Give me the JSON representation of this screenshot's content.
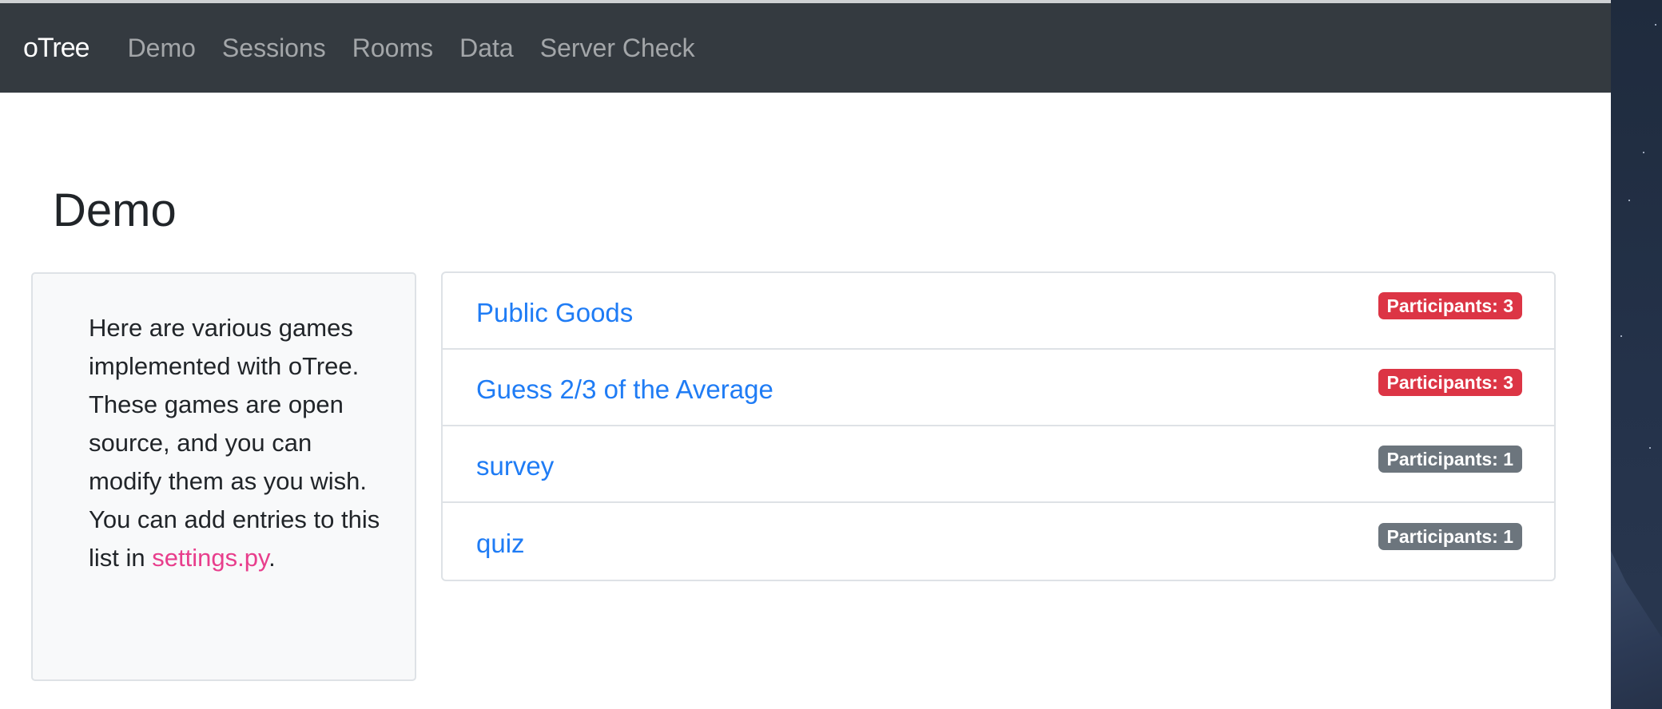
{
  "navbar": {
    "brand": "oTree",
    "links": [
      "Demo",
      "Sessions",
      "Rooms",
      "Data",
      "Server Check"
    ]
  },
  "page": {
    "title": "Demo"
  },
  "info": {
    "text1": "Here are various games implemented with oTree. These games are open source, and you can modify them as you wish.",
    "text2_prefix": "You can add entries to this list in ",
    "text2_link": "settings.py",
    "text2_suffix": "."
  },
  "apps": [
    {
      "name": "Public Goods",
      "badge": "Participants: 3",
      "badge_color": "#dc3545"
    },
    {
      "name": "Guess 2/3 of the Average",
      "badge": "Participants: 3",
      "badge_color": "#dc3545"
    },
    {
      "name": "survey",
      "badge": "Participants: 1",
      "badge_color": "#6c757d"
    },
    {
      "name": "quiz",
      "badge": "Participants: 1",
      "badge_color": "#6c757d"
    }
  ],
  "colors": {
    "navbar_bg": "#343a40",
    "link": "#1f7cf5",
    "code": "#e83e8c"
  }
}
